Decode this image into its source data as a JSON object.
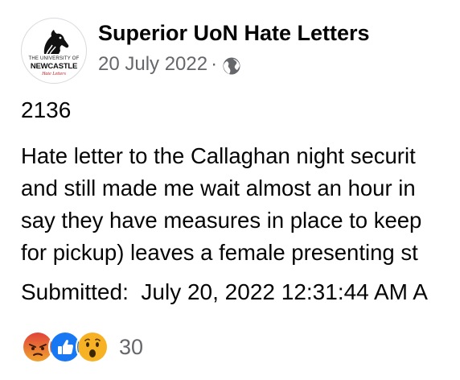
{
  "post": {
    "page_name": "Superior UoN Hate Letters",
    "date": "20 July 2022",
    "separator": "·",
    "privacy_icon": "globe-icon",
    "avatar": {
      "line1": "THE UNIVERSITY OF",
      "line2": "NEWCASTLE",
      "line3": "Hate Letters"
    },
    "number": "2136",
    "body_lines": [
      "Hate letter to the Callaghan night securit",
      "and still made me wait almost an hour in",
      "say they have measures in place to keep",
      "for pickup) leaves a female presenting st"
    ],
    "submitted": "Submitted:  July 20, 2022 12:31:44 AM A"
  },
  "reactions": {
    "icons": [
      "angry-reaction-icon",
      "like-reaction-icon",
      "wow-reaction-icon"
    ],
    "count": "30",
    "colors": {
      "like": "#1877f2",
      "angry": "#e9710f",
      "wow": "#f7b125"
    }
  }
}
